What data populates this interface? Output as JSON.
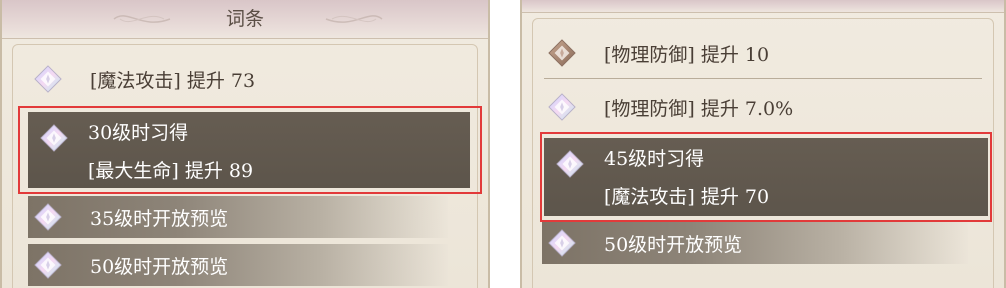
{
  "left": {
    "title": "词条",
    "rows": {
      "attr1": "[魔法攻击] 提升 73",
      "unlocked_level": "30级时习得",
      "unlocked_attr": "[最大生命] 提升 89",
      "preview1": "35级时开放预览",
      "preview2": "50级时开放预览"
    }
  },
  "right": {
    "rows": {
      "attr1": "[物理防御] 提升 10",
      "attr2": "[物理防御] 提升 7.0%",
      "unlocked_level": "45级时习得",
      "unlocked_attr": "[魔法攻击] 提升 70",
      "preview1": "50级时开放预览"
    }
  },
  "colors": {
    "highlight_border": "#e23a3a",
    "active_block": "#5f574d",
    "panel_bg": "#efe9de"
  },
  "icons": {
    "diamond_pastel": "diamond-gem-icon",
    "diamond_bronze": "diamond-gem-bronze-icon"
  }
}
